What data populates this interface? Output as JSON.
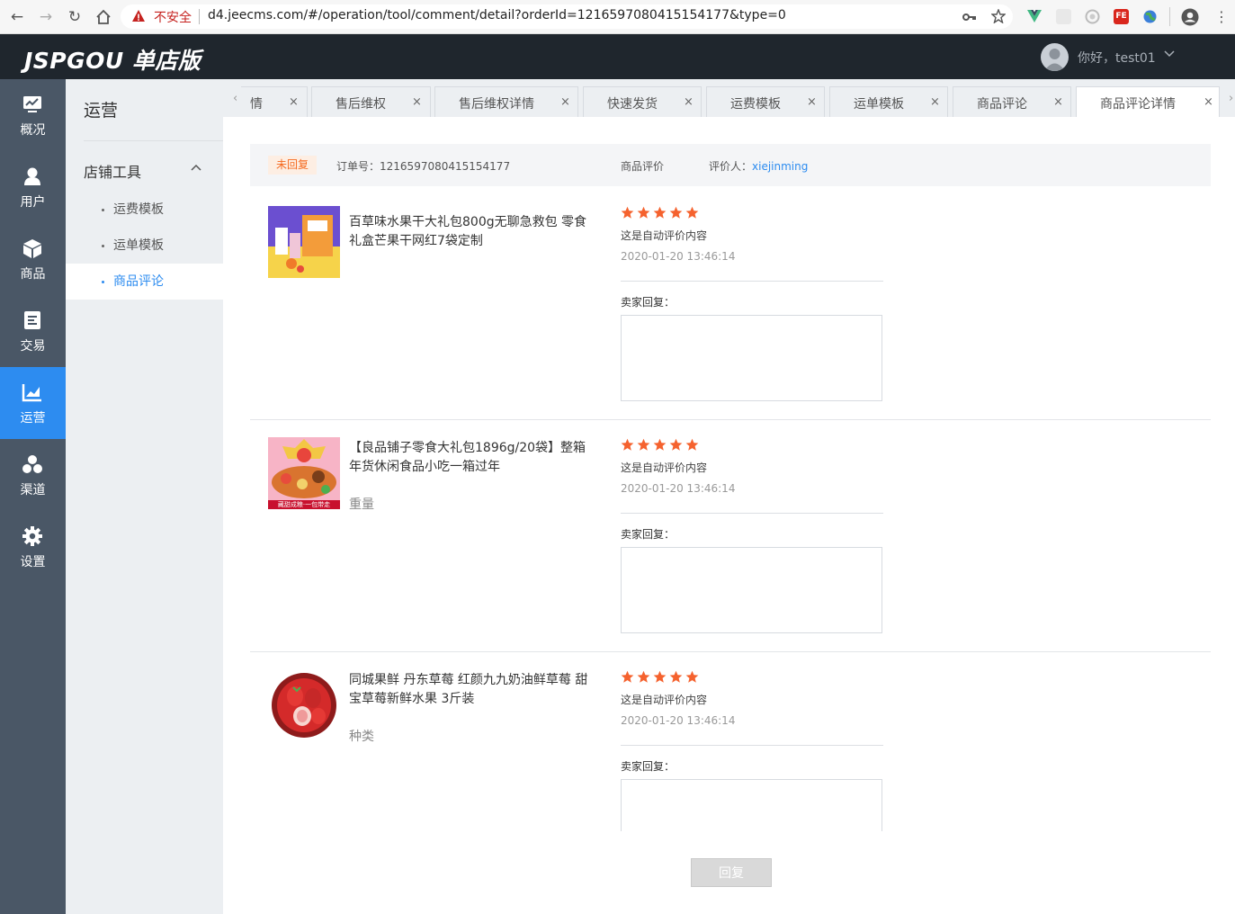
{
  "browser": {
    "insecure_label": "不安全",
    "url": "d4.jeecms.com/#/operation/tool/comment/detail?orderId=1216597080415154177&type=0"
  },
  "header": {
    "logo": "JSPGOU 单店版",
    "greeting": "你好，test01"
  },
  "leftnav": [
    {
      "label": "概况",
      "icon": "dashboard-icon"
    },
    {
      "label": "用户",
      "icon": "user-icon"
    },
    {
      "label": "商品",
      "icon": "cube-icon"
    },
    {
      "label": "交易",
      "icon": "document-icon"
    },
    {
      "label": "运营",
      "icon": "chart-icon",
      "active": true
    },
    {
      "label": "渠道",
      "icon": "channel-icon"
    },
    {
      "label": "设置",
      "icon": "gear-icon"
    }
  ],
  "subnav": {
    "title": "运营",
    "group": "店铺工具",
    "items": [
      "运费模板",
      "运单模板",
      "商品评论"
    ],
    "active_index": 2
  },
  "tabs": [
    {
      "label": "情"
    },
    {
      "label": "售后维权"
    },
    {
      "label": "售后维权详情"
    },
    {
      "label": "快速发货"
    },
    {
      "label": "运费模板"
    },
    {
      "label": "运单模板"
    },
    {
      "label": "商品评论"
    },
    {
      "label": "商品评论详情",
      "active": true
    }
  ],
  "info": {
    "status": "未回复",
    "order_label": "订单号：",
    "order_no": "1216597080415154177",
    "type_label": "商品评价",
    "reviewer_label": "评价人：",
    "reviewer": "xiejinming"
  },
  "reviews": [
    {
      "title": "百草味水果干大礼包800g无聊急救包 零食礼盒芒果干网红7袋定制",
      "spec": "",
      "rating": 5,
      "content": "这是自动评价内容",
      "time": "2020-01-20 13:46:14",
      "reply_label": "卖家回复：",
      "reply_value": ""
    },
    {
      "title": "【良品铺子零食大礼包1896g/20袋】整箱年货休闲食品小吃一箱过年",
      "spec": "重量",
      "img_banner": "藏甜成粮·一包带走",
      "rating": 5,
      "content": "这是自动评价内容",
      "time": "2020-01-20 13:46:14",
      "reply_label": "卖家回复：",
      "reply_value": ""
    },
    {
      "title": "同城果鲜 丹东草莓 红颜九九奶油鲜草莓 甜宝草莓新鲜水果 3斤装",
      "spec": "种类",
      "rating": 5,
      "content": "这是自动评价内容",
      "time": "2020-01-20 13:46:14",
      "reply_label": "卖家回复：",
      "reply_value": ""
    }
  ],
  "submit_label": "回复",
  "colors": {
    "accent": "#2d8cf0",
    "star": "#f5622e",
    "header": "#1f262d",
    "leftnav": "#4a5766"
  }
}
